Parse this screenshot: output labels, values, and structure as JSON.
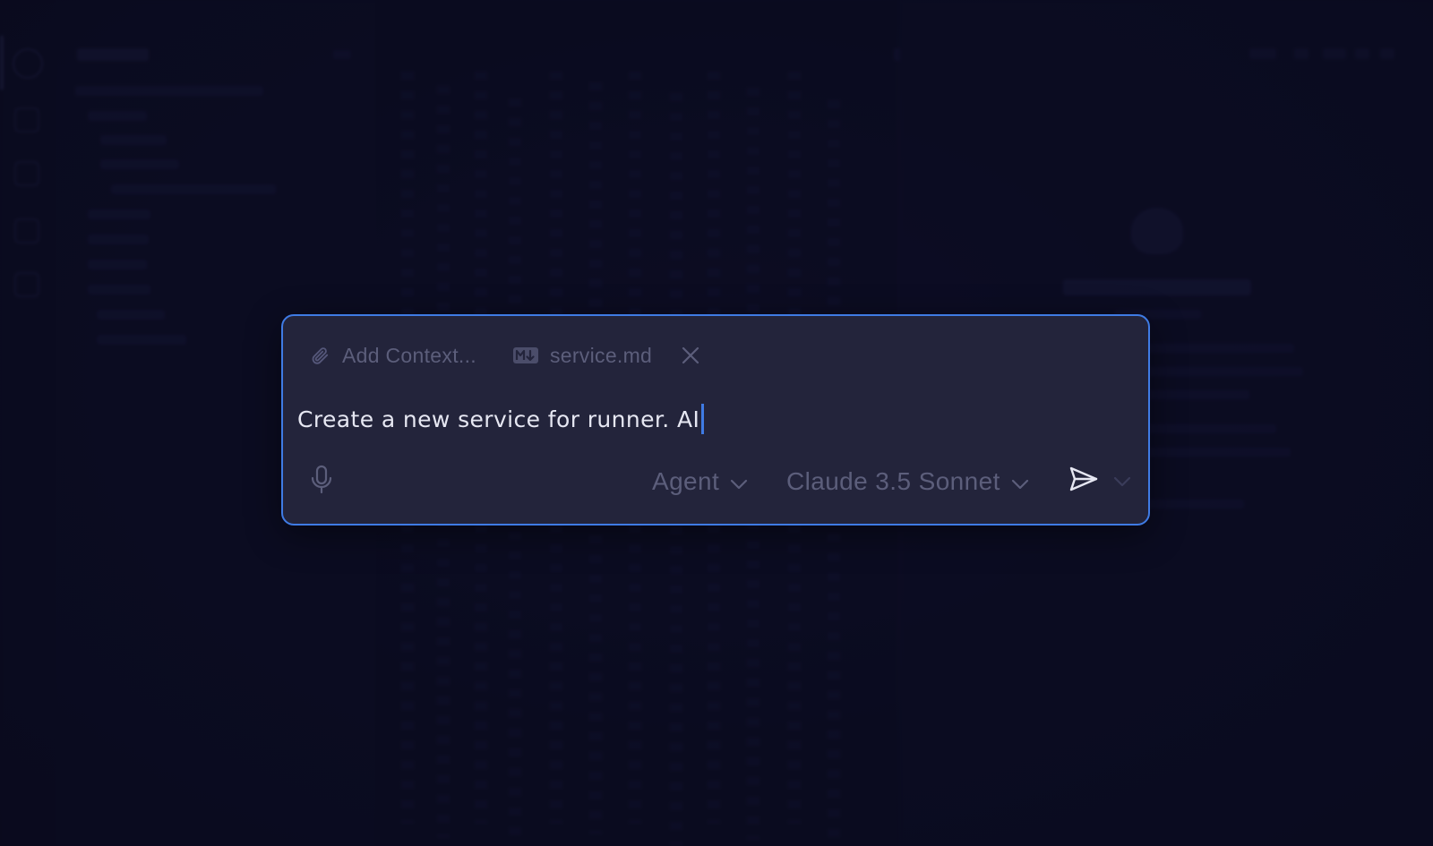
{
  "dialog": {
    "context": {
      "add_label": "Add Context...",
      "add_icon": "paperclip-icon",
      "attached_file": "service.md",
      "attached_file_icon": "markdown-file-icon",
      "remove_icon": "close-icon"
    },
    "input": {
      "value": "Create a new service for runner. AI"
    },
    "toolbar": {
      "mic_icon": "microphone-icon",
      "mode": "Agent",
      "model": "Claude 3.5 Sonnet",
      "send_icon": "send-icon",
      "send_options_icon": "chevron-down-icon"
    }
  },
  "colors": {
    "background": "#0d0e24",
    "dialog_background": "#23243b",
    "accent": "#3f7be4",
    "muted_text": "#5c5e7b",
    "input_text": "#e6e7f2"
  }
}
